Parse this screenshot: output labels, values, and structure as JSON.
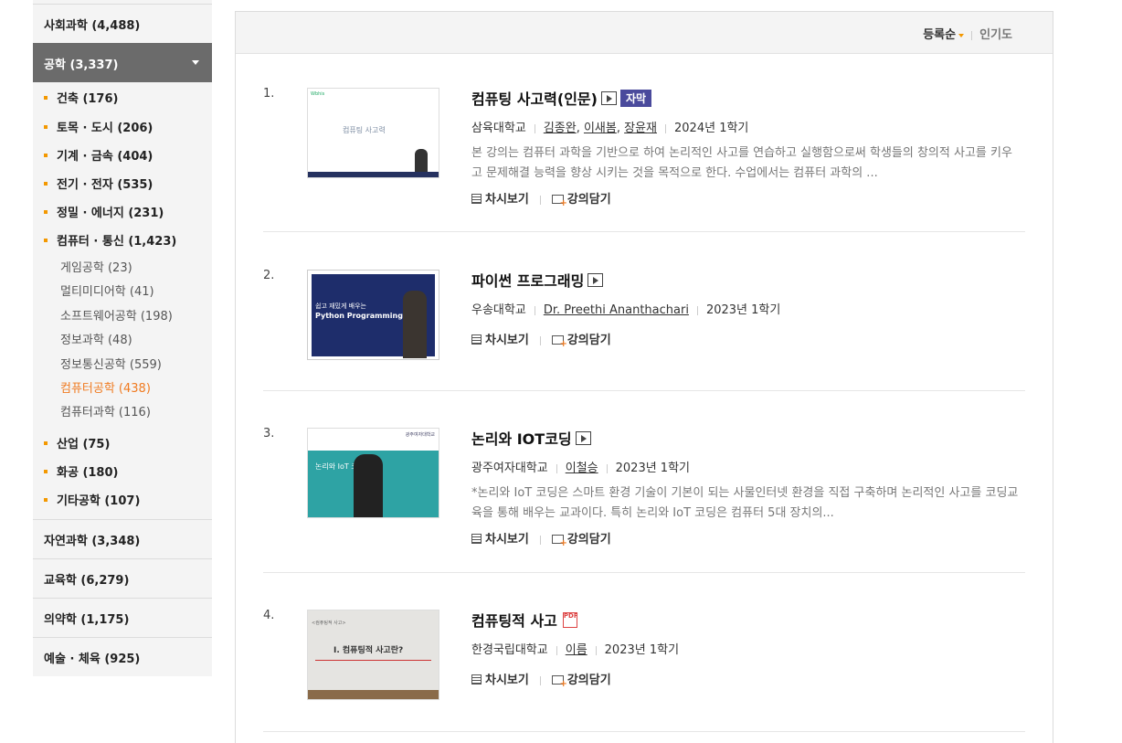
{
  "sidebar": {
    "top_category": "사회과학 (4,488)",
    "active_category": "공학 (3,337)",
    "subcategories": [
      "건축 (176)",
      "토목 · 도시 (206)",
      "기계 · 금속 (404)",
      "전기 · 전자 (535)",
      "정밀 · 에너지 (231)",
      "컴퓨터 · 통신 (1,423)"
    ],
    "sub_subcategories": [
      "게임공학 (23)",
      "멀티미디어학 (41)",
      "소프트웨어공학 (198)",
      "정보과학 (48)",
      "정보통신공학 (559)",
      "컴퓨터공학 (438)",
      "컴퓨터과학 (116)"
    ],
    "active_sub_subcategory": "컴퓨터공학 (438)",
    "subcategories_after": [
      "산업 (75)",
      "화공 (180)",
      "기타공학 (107)"
    ],
    "other_categories": [
      "자연과학 (3,348)",
      "교육학 (6,279)",
      "의약학 (1,175)",
      "예술 · 체육 (925)"
    ],
    "accent_color": "#f39800",
    "active_color": "#f07b21"
  },
  "sort": {
    "active": "등록순",
    "inactive": "인기도"
  },
  "actions": {
    "view": "차시보기",
    "save": "강의담기"
  },
  "courses": [
    {
      "num": "1.",
      "title": "컴퓨팅 사고력(인문)",
      "badge": "자막",
      "school": "삼육대학교",
      "profs": [
        "김종완",
        "이새봄",
        "장윤재"
      ],
      "term": "2024년 1학기",
      "desc": "본 강의는 컴퓨터 과학을 기반으로 하여 논리적인 사고를 연습하고 실행함으로써 학생들의 창의적 사고를 키우고 문제해결 능력을 향상 시키는 것을 목적으로 한다. 수업에서는 컴퓨터 과학의 ...",
      "thumb_text": "컴퓨팅 사고력"
    },
    {
      "num": "2.",
      "title": "파이썬 프로그래밍",
      "school": "우송대학교",
      "profs": [
        "Dr. Preethi Ananthachari"
      ],
      "term": "2023년 1학기",
      "thumb_text": "쉽고 재밌게 배우는",
      "thumb_text2": "Python Programming"
    },
    {
      "num": "3.",
      "title": "논리와 IOT코딩",
      "school": "광주여자대학교",
      "profs": [
        "이철승"
      ],
      "term": "2023년 1학기",
      "desc": "*논리와 IoT 코딩은 스마트 환경 기술이 기본이 되는 사물인터넷 환경을 직접 구축하며 논리적인 사고를 코딩교육을 통해 배우는 교과이다. 특히 논리와 IoT 코딩은 컴퓨터 5대 장치의...",
      "thumb_text": "논리와 IoT 코딩"
    },
    {
      "num": "4.",
      "title": "컴퓨팅적 사고",
      "school": "한경국립대학교",
      "profs": [
        "이름"
      ],
      "term": "2023년 1학기",
      "thumb_text": "I. 컴퓨팅적 사고란?"
    }
  ]
}
